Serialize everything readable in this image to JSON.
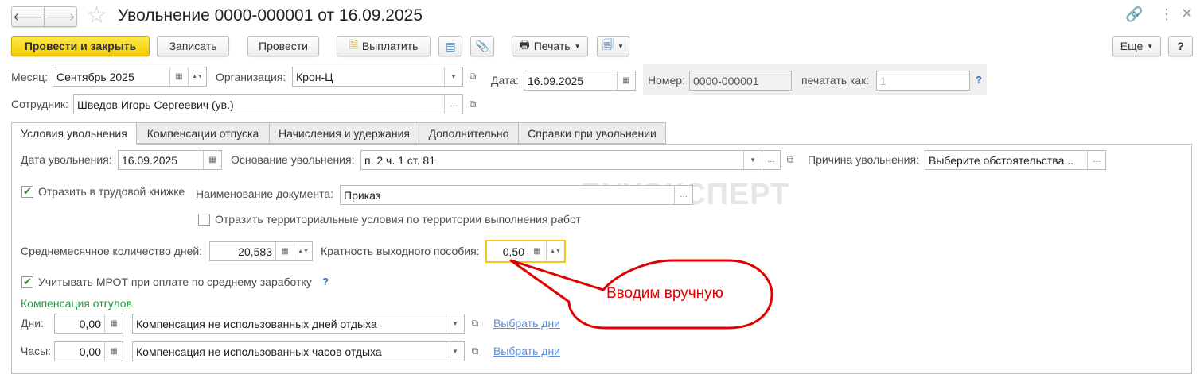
{
  "header": {
    "title": "Увольнение 0000-000001 от 16.09.2025",
    "back": "🡐",
    "forward": "🡒"
  },
  "toolbar": {
    "post_close": "Провести и закрыть",
    "save": "Записать",
    "post": "Провести",
    "pay": "Выплатить",
    "print": "Печать",
    "more": "Еще",
    "help": "?"
  },
  "form": {
    "month_label": "Месяц:",
    "month": "Сентябрь 2025",
    "org_label": "Организация:",
    "org": "Крон-Ц",
    "date_label": "Дата:",
    "date": "16.09.2025",
    "number_label": "Номер:",
    "number": "0000-000001",
    "print_as_label": "печатать как:",
    "print_as_placeholder": "1",
    "help": "?",
    "employee_label": "Сотрудник:",
    "employee": "Шведов Игорь Сергеевич (ув.)"
  },
  "tabs": [
    "Условия увольнения",
    "Компенсации отпуска",
    "Начисления и удержания",
    "Дополнительно",
    "Справки при увольнении"
  ],
  "dismissal": {
    "date_label": "Дата увольнения:",
    "date": "16.09.2025",
    "basis_label": "Основание увольнения:",
    "basis": "п. 2 ч. 1 ст. 81",
    "reason_label": "Причина увольнения:",
    "reason": "Выберите обстоятельства...",
    "workbook_label": "Отразить в трудовой книжке",
    "workbook_checked": true,
    "docname_label": "Наименование документа:",
    "docname": "Приказ",
    "territorial_label": "Отразить территориальные условия по территории выполнения работ",
    "territorial_checked": false,
    "avg_days_label": "Среднемесячное количество дней:",
    "avg_days": "20,583",
    "multiplier_label": "Кратность выходного пособия:",
    "multiplier": "0,50",
    "mrot_label": "Учитывать МРОТ при оплате по среднему заработку",
    "mrot_checked": true,
    "mrot_help": "?",
    "comp_title": "Компенсация отгулов",
    "days_label": "Дни:",
    "days": "0,00",
    "days_type": "Компенсация не использованных дней отдыха",
    "days_link": "Выбрать дни",
    "hours_label": "Часы:",
    "hours": "0,00",
    "hours_type": "Компенсация не использованных часов отдыха",
    "hours_link": "Выбрать дни"
  },
  "watermark": "БУХЭКСПЕРТ",
  "callout": "Вводим вручную"
}
